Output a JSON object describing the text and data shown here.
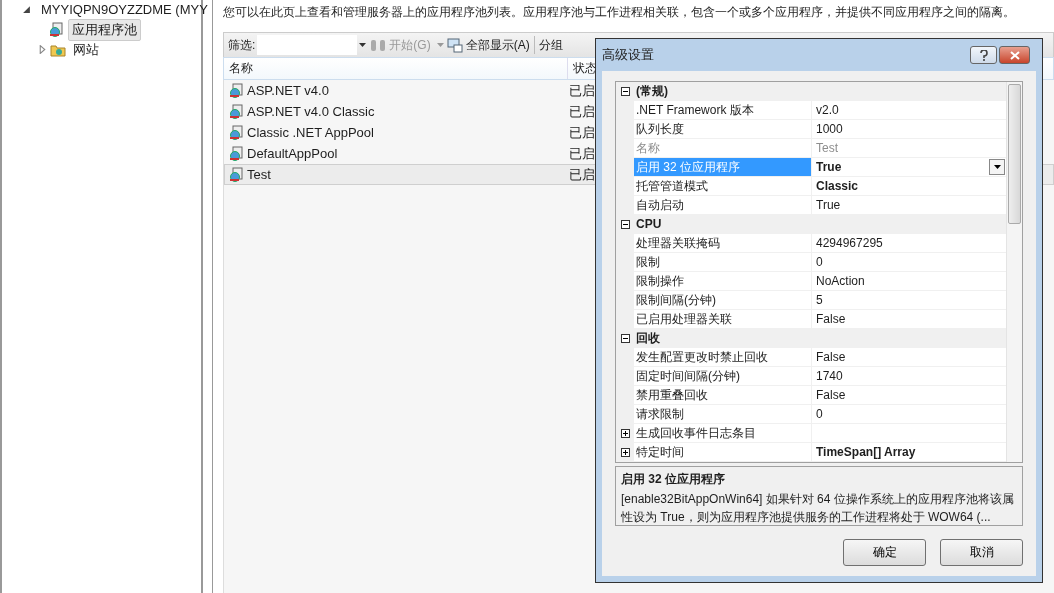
{
  "tree": {
    "label": "MYYIQPN9OYZZDME (MYY",
    "expanded": true,
    "children": [
      {
        "label": "应用程序池",
        "selected": true
      },
      {
        "label": "网站",
        "selected": false,
        "expanded": false
      }
    ]
  },
  "description": "您可以在此页上查看和管理服务器上的应用程序池列表。应用程序池与工作进程相关联，包含一个或多个应用程序，并提供不同应用程序之间的隔离。",
  "toolbar": {
    "filter_label": "筛选:",
    "start": {
      "label": "开始(G)",
      "disabled": true
    },
    "show_all": {
      "label": "全部显示(A)",
      "disabled": false
    },
    "group": {
      "label": "分组",
      "disabled": false
    }
  },
  "list": {
    "columns": [
      "名称",
      "状态"
    ],
    "rows": [
      {
        "name": "ASP.NET v4.0",
        "status": "已启",
        "selected": false
      },
      {
        "name": "ASP.NET v4.0 Classic",
        "status": "已启",
        "selected": false
      },
      {
        "name": "Classic .NET AppPool",
        "status": "已启",
        "selected": false
      },
      {
        "name": "DefaultAppPool",
        "status": "已启",
        "selected": false
      },
      {
        "name": "Test",
        "status": "已启",
        "selected": true
      }
    ]
  },
  "dialog": {
    "title": "高级设置",
    "categories": [
      {
        "name": "(常规)",
        "expanded": true,
        "properties": [
          {
            "name": ".NET Framework 版本",
            "value": "v2.0",
            "disabled": false,
            "selected": false
          },
          {
            "name": "队列长度",
            "value": "1000",
            "disabled": false,
            "selected": false
          },
          {
            "name": "名称",
            "value": "Test",
            "disabled": true,
            "selected": false
          },
          {
            "name": "启用 32 位应用程序",
            "value": "True",
            "bold": true,
            "disabled": false,
            "selected": true
          },
          {
            "name": "托管管道模式",
            "value": "Classic",
            "bold": true,
            "disabled": false,
            "selected": false
          },
          {
            "name": "自动启动",
            "value": "True",
            "disabled": false,
            "selected": false
          }
        ]
      },
      {
        "name": "CPU",
        "expanded": true,
        "properties": [
          {
            "name": "处理器关联掩码",
            "value": "4294967295",
            "disabled": false,
            "selected": false
          },
          {
            "name": "限制",
            "value": "0",
            "disabled": false,
            "selected": false
          },
          {
            "name": "限制操作",
            "value": "NoAction",
            "disabled": false,
            "selected": false
          },
          {
            "name": "限制间隔(分钟)",
            "value": "5",
            "disabled": false,
            "selected": false
          },
          {
            "name": "已启用处理器关联",
            "value": "False",
            "disabled": false,
            "selected": false
          }
        ]
      },
      {
        "name": "回收",
        "expanded": true,
        "properties": [
          {
            "name": "发生配置更改时禁止回收",
            "value": "False",
            "disabled": false,
            "selected": false
          },
          {
            "name": "固定时间间隔(分钟)",
            "value": "1740",
            "disabled": false,
            "selected": false
          },
          {
            "name": "禁用重叠回收",
            "value": "False",
            "disabled": false,
            "selected": false
          },
          {
            "name": "请求限制",
            "value": "0",
            "disabled": false,
            "selected": false
          },
          {
            "name": "生成回收事件日志条目",
            "disabled": false,
            "selected": false,
            "expanded": false
          },
          {
            "name": "特定时间",
            "value": "TimeSpan[] Array",
            "bold": true,
            "disabled": false,
            "selected": false,
            "expanded": false
          }
        ]
      }
    ],
    "help_title": "启用 32 位应用程序",
    "help_text": "[enable32BitAppOnWin64] 如果针对 64 位操作系统上的应用程序池将该属性设为 True，则为应用程序池提供服务的工作进程将处于 WOW64 (...",
    "buttons": [
      "确定",
      "取消"
    ]
  }
}
